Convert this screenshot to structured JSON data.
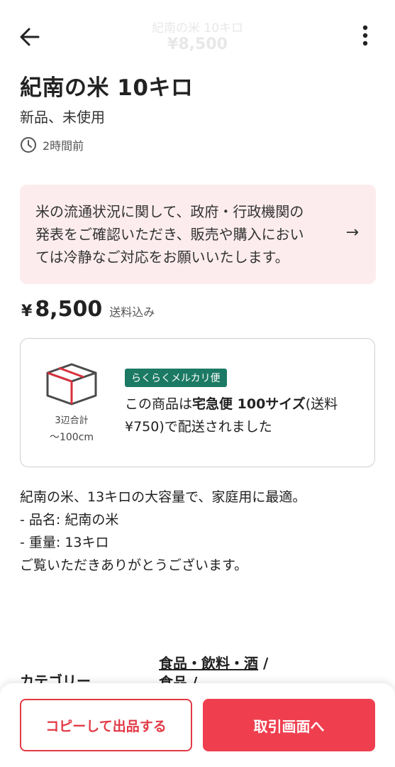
{
  "header": {
    "title": "紀南の米 10キロ",
    "price": "¥8,500",
    "back_icon": "arrow-left-icon",
    "menu_icon": "more-vertical-icon"
  },
  "item": {
    "title": "紀南の米 10キロ",
    "condition": "新品、未使用",
    "posted": "2時間前",
    "clock_icon": "clock-icon"
  },
  "notice": {
    "lines": [
      "米の流通状況に関して、政府・行政機関の",
      "発表をご確認いただき、販売や購入におい",
      "ては冷静なご対応をお願いいたします。"
    ],
    "arrow": "→"
  },
  "price": {
    "yen": "¥",
    "amount": "8,500",
    "note": "送料込み"
  },
  "shipping": {
    "box_icon": "package-box-icon",
    "size_line1": "3辺合計",
    "size_line2": "〜100cm",
    "badge": "らくらくメルカリ便",
    "text_before": "この商品は",
    "text_bold": "宅急便 100サイズ",
    "text_after": "(送料 ¥750)で配送されました"
  },
  "description": {
    "lines": [
      "紀南の米、13キロの大容量で、家庭用に最適。",
      "",
      "- 品名: 紀南の米",
      "- 重量: 13キロ",
      "",
      "ご覧いただきありがとうございます。"
    ]
  },
  "category": {
    "label": "カテゴリー",
    "path1": "食品・飲料・酒",
    "sep1": " /",
    "path2": "食品",
    "sep2": " /"
  },
  "actions": {
    "copy_label": "コピーして出品する",
    "trade_label": "取引画面へ"
  },
  "colors": {
    "accent": "#ef3f4f",
    "notice_bg": "#fcecee",
    "badge_green": "#1c7a64"
  }
}
